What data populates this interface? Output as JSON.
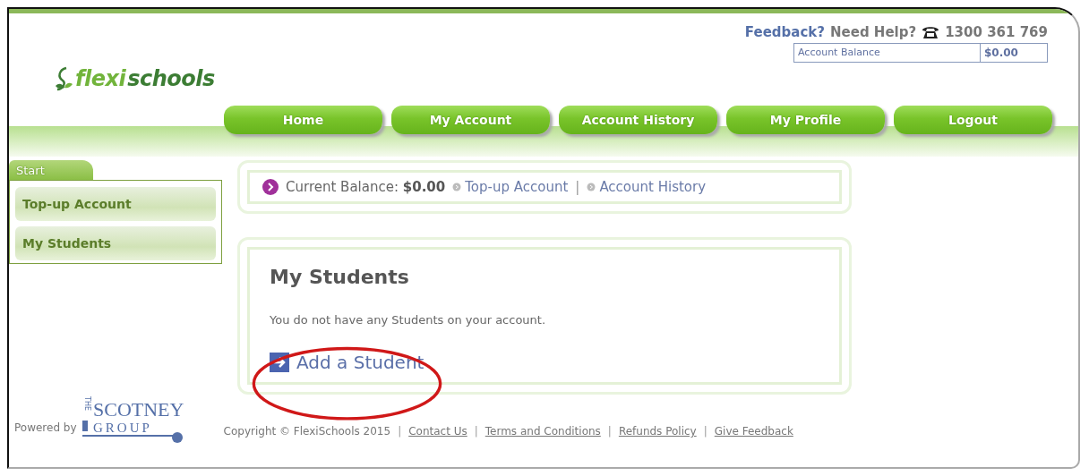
{
  "header": {
    "logo": {
      "prefix": "flexi",
      "suffix": "schools"
    },
    "help": {
      "feedback": "Feedback?",
      "need_help": "Need Help?",
      "phone": "1300 361 769"
    },
    "balance_box": {
      "label": "Account Balance",
      "value": "$0.00"
    }
  },
  "nav": [
    "Home",
    "My Account",
    "Account History",
    "My Profile",
    "Logout"
  ],
  "sidebar": {
    "tab": "Start",
    "items": [
      "Top-up Account",
      "My Students"
    ]
  },
  "balance_bar": {
    "label": "Current Balance:",
    "value": "$0.00",
    "links": [
      "Top-up Account",
      "Account History"
    ],
    "separator": "|"
  },
  "students_panel": {
    "title": "My Students",
    "message": "You do not have any Students on your account.",
    "action": "Add a Student"
  },
  "footer": {
    "powered_by": "Powered by",
    "partner_logo": {
      "small": "THE",
      "name": "SCOTNEY",
      "sub": "GROUP"
    },
    "copyright": "Copyright © FlexiSchools 2015",
    "separator": "|",
    "links": [
      "Contact Us",
      "Terms and Conditions",
      "Refunds Policy",
      "Give Feedback"
    ]
  }
}
